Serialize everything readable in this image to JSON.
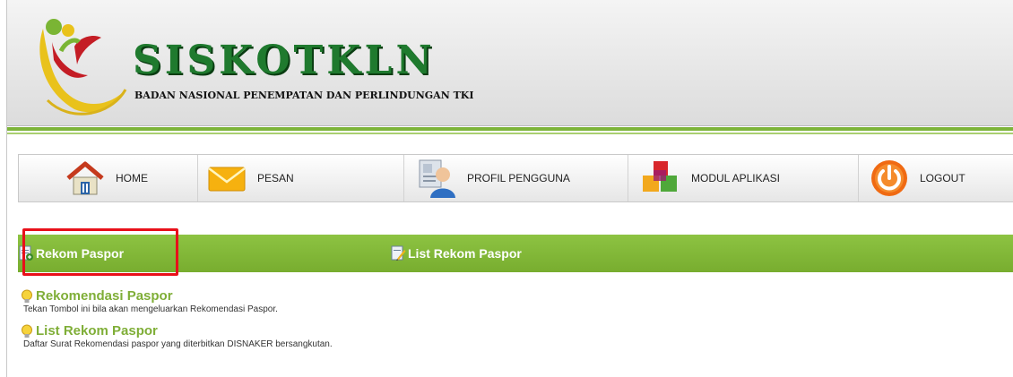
{
  "header": {
    "title": "SISKOTKLN",
    "subtitle": "BADAN NASIONAL PENEMPATAN DAN PERLINDUNGAN TKI"
  },
  "nav": {
    "items": [
      {
        "label": "HOME",
        "icon": "home-icon"
      },
      {
        "label": "PESAN",
        "icon": "envelope-icon"
      },
      {
        "label": "PROFIL PENGGUNA",
        "icon": "user-profile-icon"
      },
      {
        "label": "MODUL APLIKASI",
        "icon": "modules-icon"
      },
      {
        "label": "LOGOUT",
        "icon": "power-icon"
      }
    ]
  },
  "tabs": [
    {
      "label": "Rekom Paspor",
      "icon": "document-add-icon",
      "highlighted": true
    },
    {
      "label": "List Rekom Paspor",
      "icon": "document-edit-icon",
      "highlighted": false
    }
  ],
  "content": {
    "items": [
      {
        "title": "Rekomendasi Paspor",
        "description": "Tekan Tombol ini bila akan mengeluarkan Rekomendasi Paspor."
      },
      {
        "title": "List Rekom Paspor",
        "description": "Daftar Surat Rekomendasi paspor yang diterbitkan DISNAKER bersangkutan."
      }
    ]
  },
  "colors": {
    "brand_green": "#1f7a2e",
    "tab_green": "#82b83a",
    "link_green": "#7fae37",
    "highlight_red": "#e8101a",
    "logo_yellow": "#e9c21b",
    "logo_red": "#c41d25"
  }
}
